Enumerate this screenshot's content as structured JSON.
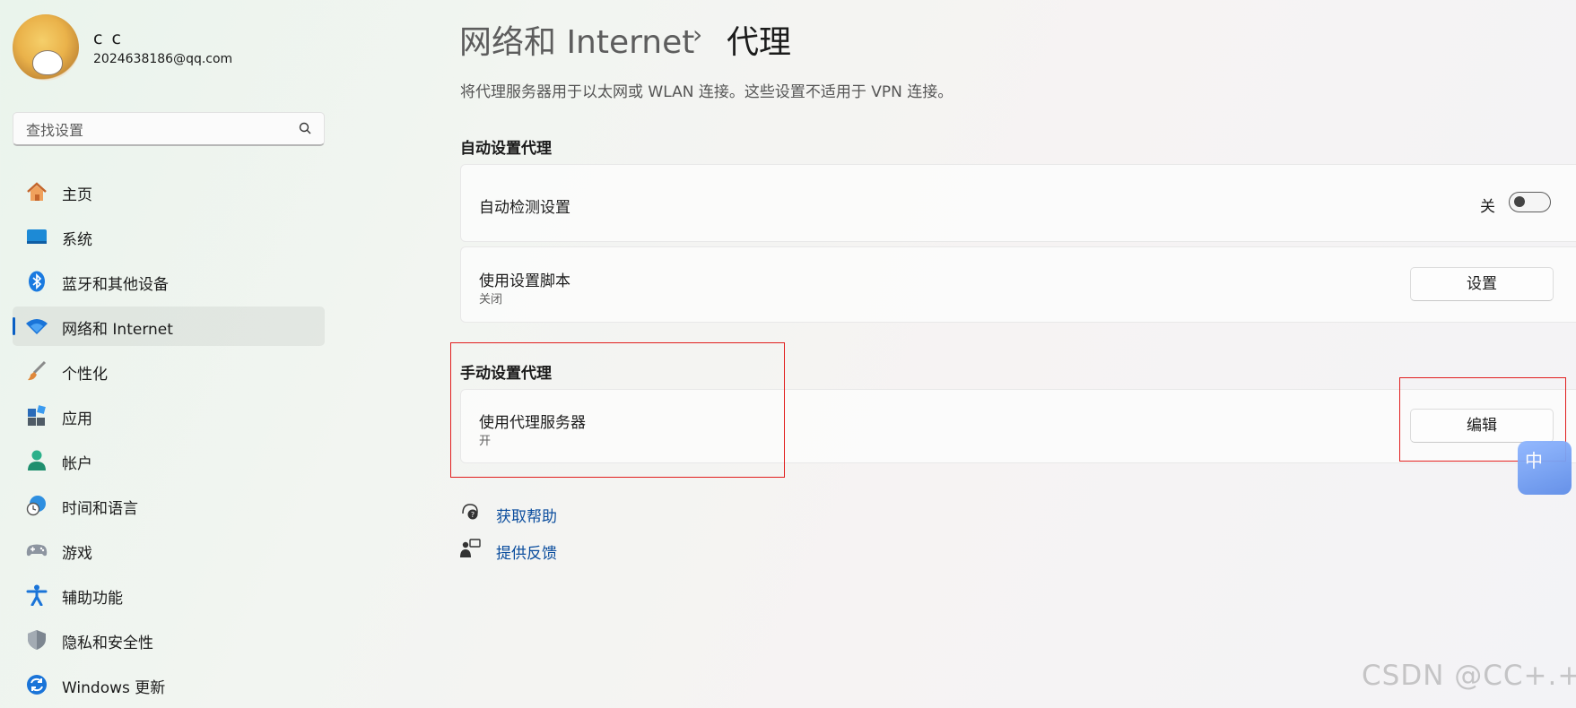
{
  "user": {
    "name": "c c",
    "email": "2024638186@qq.com"
  },
  "search": {
    "placeholder": "查找设置"
  },
  "sidebar": {
    "items": [
      {
        "label": "主页",
        "icon": "home-icon"
      },
      {
        "label": "系统",
        "icon": "display-icon"
      },
      {
        "label": "蓝牙和其他设备",
        "icon": "bluetooth-icon"
      },
      {
        "label": "网络和 Internet",
        "icon": "wifi-icon",
        "active": true
      },
      {
        "label": "个性化",
        "icon": "paintbrush-icon"
      },
      {
        "label": "应用",
        "icon": "apps-icon"
      },
      {
        "label": "帐户",
        "icon": "person-icon"
      },
      {
        "label": "时间和语言",
        "icon": "globe-clock-icon"
      },
      {
        "label": "游戏",
        "icon": "gamepad-icon"
      },
      {
        "label": "辅助功能",
        "icon": "accessibility-icon"
      },
      {
        "label": "隐私和安全性",
        "icon": "shield-icon"
      },
      {
        "label": "Windows 更新",
        "icon": "update-icon"
      }
    ]
  },
  "header": {
    "parent": "网络和 Internet",
    "separator": "›",
    "current": "代理"
  },
  "description": "将代理服务器用于以太网或 WLAN 连接。这些设置不适用于 VPN 连接。",
  "auto": {
    "section_title": "自动设置代理",
    "detect": {
      "title": "自动检测设置",
      "state": "关",
      "on": false
    },
    "script": {
      "title": "使用设置脚本",
      "subtitle": "关闭",
      "button": "设置"
    }
  },
  "manual": {
    "section_title": "手动设置代理",
    "proxy": {
      "title": "使用代理服务器",
      "subtitle": "开",
      "button": "编辑"
    }
  },
  "links": {
    "help": "获取帮助",
    "feedback": "提供反馈"
  },
  "floating_widget": {
    "text": "中"
  },
  "watermark": "CSDN @CC+.+",
  "colors": {
    "accent": "#0a5fc4",
    "link": "#0b4d9e",
    "highlight_box": "#e11e1e"
  }
}
